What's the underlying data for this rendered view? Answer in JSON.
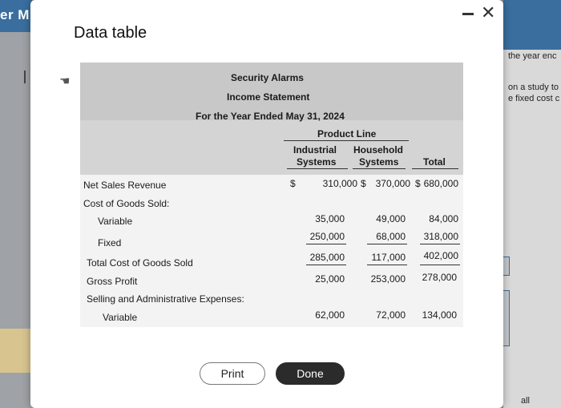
{
  "background": {
    "top_left_text": "er M",
    "right_texts": [
      "the year enc",
      "on a study to",
      "e fixed cost c"
    ],
    "bottom_right_text": "all"
  },
  "dialog": {
    "title": "Data table",
    "minimize_label": "-",
    "close_label": "✕"
  },
  "statement": {
    "company": "Security Alarms",
    "name": "Income Statement",
    "period": "For the Year Ended May 31, 2024",
    "group_header": "Product Line",
    "columns": [
      "Industrial Systems",
      "Household Systems",
      "Total"
    ],
    "col1_line1": "Industrial",
    "col1_line2": "Systems",
    "col2_line1": "Household",
    "col2_line2": "Systems",
    "col3": "Total",
    "rows": [
      {
        "label": "Net Sales Revenue",
        "prefix1": "$",
        "v1": "310,000",
        "prefix2": "$",
        "v2": "370,000",
        "prefix3": "$",
        "v3": "680,000"
      },
      {
        "label": "Cost of Goods Sold:",
        "v1": "",
        "v2": "",
        "v3": ""
      },
      {
        "label": "Variable",
        "v1": "35,000",
        "v2": "49,000",
        "v3": "84,000"
      },
      {
        "label": "Fixed",
        "v1": "250,000",
        "v2": "68,000",
        "v3": "318,000"
      },
      {
        "label": "Total Cost of Goods Sold",
        "v1": "285,000",
        "v2": "117,000",
        "v3": "402,000"
      },
      {
        "label": "Gross Profit",
        "v1": "25,000",
        "v2": "253,000",
        "v3": "278,000"
      },
      {
        "label": "Selling and Administrative Expenses:",
        "v1": "",
        "v2": "",
        "v3": ""
      },
      {
        "label": "Variable",
        "v1": "62,000",
        "v2": "72,000",
        "v3": "134,000"
      }
    ]
  },
  "buttons": {
    "print": "Print",
    "done": "Done"
  }
}
